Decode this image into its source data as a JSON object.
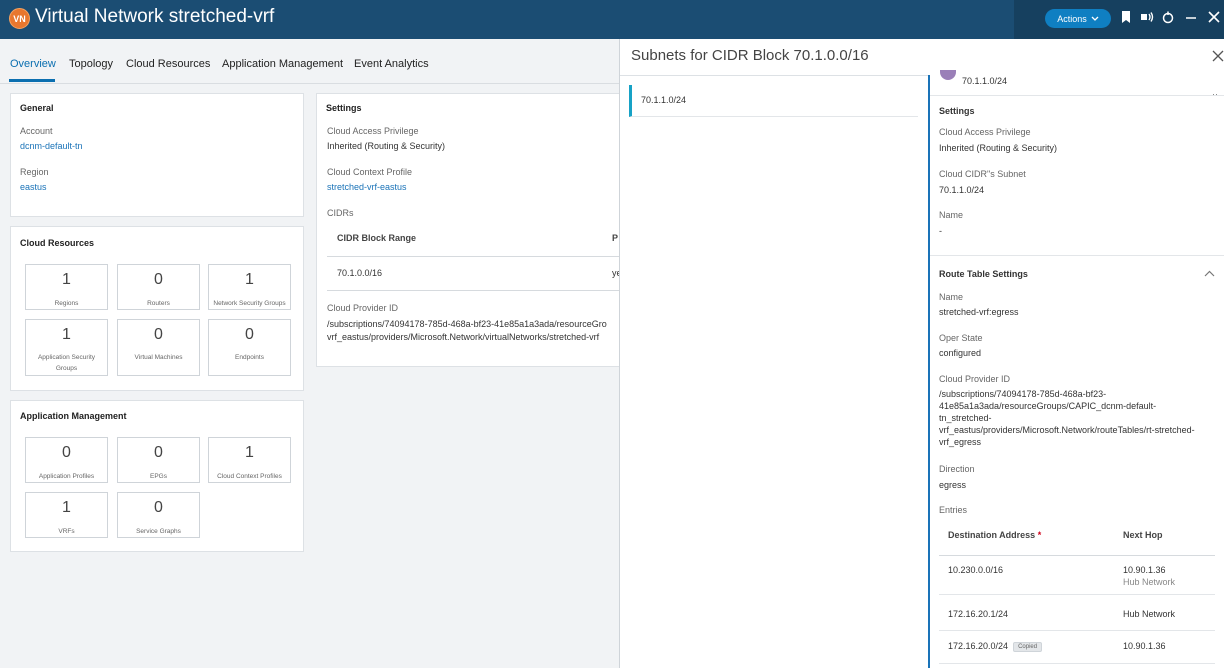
{
  "header": {
    "badge": "VN",
    "title": "Virtual Network stretched-vrf",
    "actions_label": "Actions",
    "icons": [
      "bookmark-icon",
      "feedback-icon",
      "refresh-icon",
      "minimize-icon",
      "close-icon"
    ]
  },
  "tabs": [
    {
      "label": "Overview",
      "active": true
    },
    {
      "label": "Topology"
    },
    {
      "label": "Cloud Resources"
    },
    {
      "label": "Application Management"
    },
    {
      "label": "Event Analytics"
    }
  ],
  "general": {
    "title": "General",
    "account_label": "Account",
    "account_value": "dcnm-default-tn",
    "region_label": "Region",
    "region_value": "eastus"
  },
  "cloud_resources": {
    "title": "Cloud Resources",
    "stats": [
      {
        "value": "1",
        "label": "Regions"
      },
      {
        "value": "0",
        "label": "Routers"
      },
      {
        "value": "1",
        "label": "Network Security Groups"
      },
      {
        "value": "1",
        "label": "Application Security Groups"
      },
      {
        "value": "0",
        "label": "Virtual Machines"
      },
      {
        "value": "0",
        "label": "Endpoints"
      }
    ]
  },
  "app_mgmt": {
    "title": "Application Management",
    "stats": [
      {
        "value": "0",
        "label": "Application Profiles"
      },
      {
        "value": "0",
        "label": "EPGs"
      },
      {
        "value": "1",
        "label": "Cloud Context Profiles"
      },
      {
        "value": "1",
        "label": "VRFs"
      },
      {
        "value": "0",
        "label": "Service Graphs"
      }
    ]
  },
  "settings": {
    "title": "Settings",
    "access_label": "Cloud Access Privilege",
    "access_value": "Inherited (Routing & Security)",
    "ctx_label": "Cloud Context Profile",
    "ctx_value": "stretched-vrf-eastus",
    "cidrs_label": "CIDRs",
    "col_range": "CIDR Block Range",
    "col_primary": "P",
    "row_range": "70.1.0.0/16",
    "row_primary": "ye",
    "provider_label": "Cloud Provider ID",
    "provider_line1": "/subscriptions/74094178-785d-468a-bf23-41e85a1a3ada/resourceGro",
    "provider_line2": "vrf_eastus/providers/Microsoft.Network/virtualNetworks/stretched-vrf"
  },
  "drawer": {
    "title": "Subnets for CIDR Block 70.1.0.0/16",
    "subnet": "70.1.1.0/24",
    "detail": {
      "header_subnet": "70.1.1.0/24",
      "settings_title": "Settings",
      "access_label": "Cloud Access Privilege",
      "access_value": "Inherited (Routing & Security)",
      "subnet_label": "Cloud CIDR\"s Subnet",
      "subnet_value": "70.1.1.0/24",
      "name_label": "Name",
      "name_value": "-",
      "rt_title": "Route Table Settings",
      "rt_name_label": "Name",
      "rt_name_value": "stretched-vrf:egress",
      "oper_label": "Oper State",
      "oper_value": "configured",
      "provider_label": "Cloud Provider ID",
      "provider_lines": [
        "/subscriptions/74094178-785d-468a-bf23-",
        "41e85a1a3ada/resourceGroups/CAPIC_dcnm-default-",
        "tn_stretched-",
        "vrf_eastus/providers/Microsoft.Network/routeTables/rt-stretched-",
        "vrf_egress"
      ],
      "direction_label": "Direction",
      "direction_value": "egress",
      "entries_label": "Entries",
      "col_dest": "Destination Address",
      "col_dest_req": "*",
      "col_next": "Next Hop",
      "entries": [
        {
          "dest": "10.230.0.0/16",
          "next": "10.90.1.36",
          "next2": "Hub Network",
          "badge": ""
        },
        {
          "dest": "172.16.20.1/24",
          "next": "Hub Network",
          "next2": "",
          "badge": ""
        },
        {
          "dest": "172.16.20.0/24",
          "next": "10.90.1.36",
          "next2": "",
          "badge": "Copied"
        }
      ]
    }
  }
}
